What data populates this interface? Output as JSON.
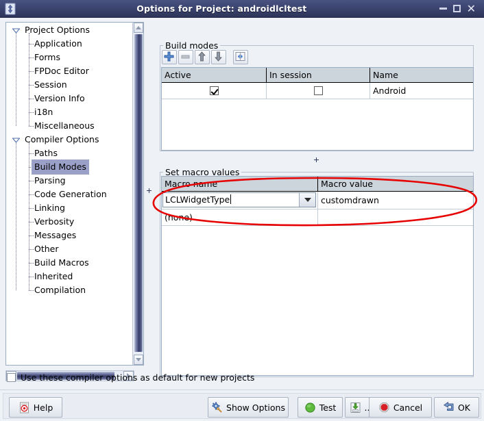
{
  "window": {
    "title": "Options for Project: androidlcltest",
    "icon": "lazarus-app-icon",
    "controls": {
      "minimize": "minimize-icon",
      "maximize": "maximize-icon",
      "close": "close-icon"
    }
  },
  "tree": {
    "nodes": [
      {
        "label": "Project Options",
        "level": 0,
        "expanded": true,
        "selected": false
      },
      {
        "label": "Application",
        "level": 1,
        "expanded": null,
        "selected": false
      },
      {
        "label": "Forms",
        "level": 1,
        "expanded": null,
        "selected": false
      },
      {
        "label": "FPDoc Editor",
        "level": 1,
        "expanded": null,
        "selected": false
      },
      {
        "label": "Session",
        "level": 1,
        "expanded": null,
        "selected": false
      },
      {
        "label": "Version Info",
        "level": 1,
        "expanded": null,
        "selected": false
      },
      {
        "label": "i18n",
        "level": 1,
        "expanded": null,
        "selected": false
      },
      {
        "label": "Miscellaneous",
        "level": 1,
        "expanded": null,
        "selected": false
      },
      {
        "label": "Compiler Options",
        "level": 0,
        "expanded": true,
        "selected": false
      },
      {
        "label": "Paths",
        "level": 1,
        "expanded": null,
        "selected": false
      },
      {
        "label": "Build Modes",
        "level": 1,
        "expanded": null,
        "selected": true
      },
      {
        "label": "Parsing",
        "level": 1,
        "expanded": null,
        "selected": false
      },
      {
        "label": "Code Generation",
        "level": 1,
        "expanded": null,
        "selected": false
      },
      {
        "label": "Linking",
        "level": 1,
        "expanded": null,
        "selected": false
      },
      {
        "label": "Verbosity",
        "level": 1,
        "expanded": null,
        "selected": false
      },
      {
        "label": "Messages",
        "level": 1,
        "expanded": null,
        "selected": false
      },
      {
        "label": "Other",
        "level": 1,
        "expanded": null,
        "selected": false
      },
      {
        "label": "Build Macros",
        "level": 1,
        "expanded": null,
        "selected": false
      },
      {
        "label": "Inherited",
        "level": 1,
        "expanded": null,
        "selected": false
      },
      {
        "label": "Compilation",
        "level": 1,
        "expanded": null,
        "selected": false
      }
    ],
    "selected_label": "Build Modes",
    "selection_color": "#9aa0c8"
  },
  "build_modes": {
    "caption": "Build modes",
    "toolbar": [
      {
        "name": "add-build-mode-button",
        "icon": "plus-icon",
        "enabled": true
      },
      {
        "name": "remove-build-mode-button",
        "icon": "minus-icon",
        "enabled": false
      },
      {
        "name": "move-build-mode-up-button",
        "icon": "arrow-up-icon",
        "enabled": true
      },
      {
        "name": "move-build-mode-down-button",
        "icon": "arrow-down-icon",
        "enabled": true
      },
      {
        "name": "build-mode-diff-button",
        "icon": "diff-icon",
        "enabled": true
      }
    ],
    "columns": [
      "Active",
      "In session",
      "Name"
    ],
    "rows": [
      {
        "active": true,
        "in_session": false,
        "name": "Android"
      }
    ]
  },
  "macros": {
    "caption": "Set macro values",
    "columns": [
      "Macro name",
      "Macro value"
    ],
    "rows": [
      {
        "name": "LCLWidgetType",
        "value": "customdrawn",
        "editing": true,
        "has_dropdown": true
      },
      {
        "name": "(none)",
        "value": "",
        "editing": false,
        "has_dropdown": false
      }
    ]
  },
  "default_option": {
    "label": "Use these compiler options as default for new projects",
    "checked": false
  },
  "buttons": {
    "help": "Help",
    "show_options": "Show Options",
    "test": "Test",
    "dots": "...",
    "cancel": "Cancel",
    "ok": "OK"
  },
  "annotation": {
    "type": "hand-drawn-ellipse",
    "color": "#e60000",
    "target": "LCLWidgetType macro row"
  }
}
